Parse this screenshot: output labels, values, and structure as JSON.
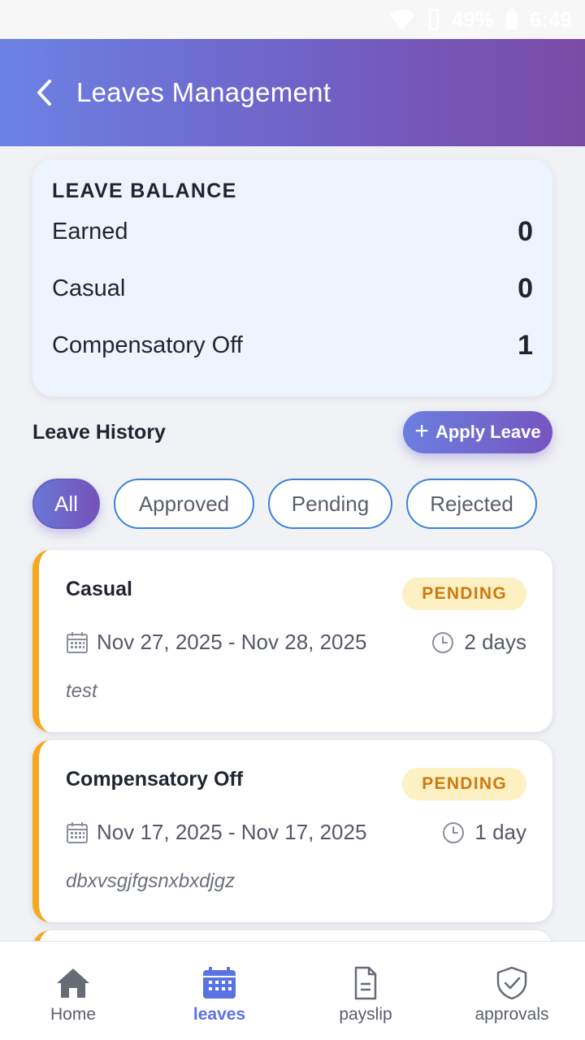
{
  "status_bar": {
    "battery": "49%",
    "time": "6:49"
  },
  "header": {
    "title": "Leaves Management"
  },
  "balance": {
    "title": "LEAVE BALANCE",
    "rows": [
      {
        "label": "Earned",
        "value": "0"
      },
      {
        "label": "Casual",
        "value": "0"
      },
      {
        "label": "Compensatory Off",
        "value": "1"
      }
    ]
  },
  "history": {
    "title": "Leave History",
    "apply_label": "Apply Leave",
    "filters": [
      {
        "label": "All",
        "active": true
      },
      {
        "label": "Approved",
        "active": false
      },
      {
        "label": "Pending",
        "active": false
      },
      {
        "label": "Rejected",
        "active": false
      }
    ],
    "leaves": [
      {
        "type": "Casual",
        "status": "PENDING",
        "dates": "Nov 27, 2025 - Nov 28, 2025",
        "duration": "2 days",
        "reason": "test"
      },
      {
        "type": "Compensatory Off",
        "status": "PENDING",
        "dates": "Nov 17, 2025 - Nov 17, 2025",
        "duration": "1 day",
        "reason": "dbxvsgjfgsnxbxdjgz"
      }
    ]
  },
  "bottom_nav": [
    {
      "label": "Home",
      "icon": "home-icon"
    },
    {
      "label": "leaves",
      "icon": "calendar-icon",
      "active": true
    },
    {
      "label": "payslip",
      "icon": "document-icon"
    },
    {
      "label": "approvals",
      "icon": "shield-check-icon"
    }
  ],
  "colors": {
    "accent": "#6b82e4",
    "accent_dark": "#7b4aa6",
    "pending": "#f5a71f",
    "chip_border": "#3b82d6"
  }
}
